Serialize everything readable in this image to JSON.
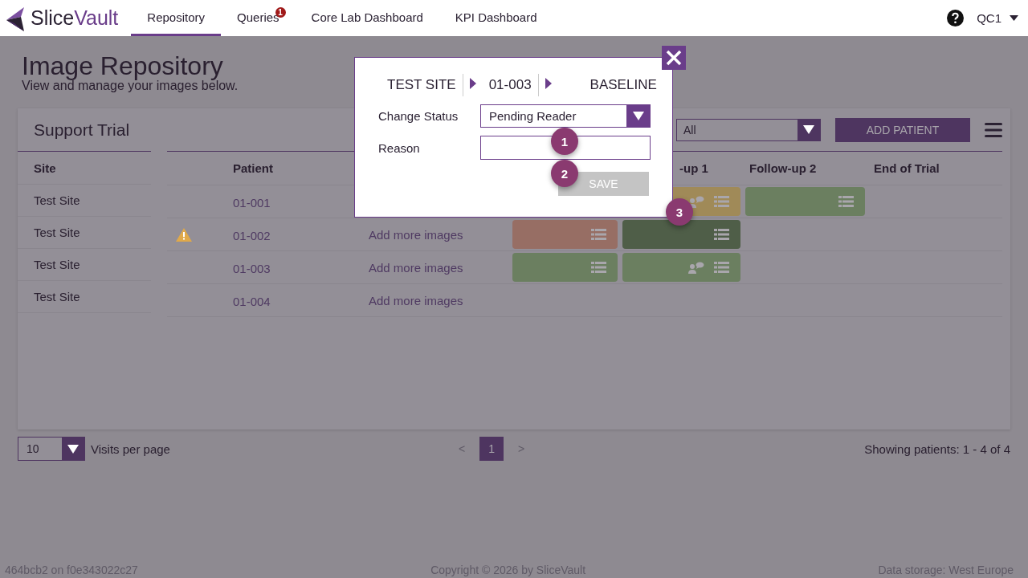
{
  "header": {
    "brand": {
      "part_1": "Slice",
      "part_2": "Vault"
    },
    "nav": [
      {
        "label": "Repository",
        "selected": true
      },
      {
        "label": "Queries",
        "selected": false,
        "badge": "1"
      },
      {
        "label": "Core Lab Dashboard",
        "selected": false
      },
      {
        "label": "KPI Dashboard",
        "selected": false
      }
    ],
    "user": "QC1"
  },
  "page": {
    "title": "Image Repository",
    "subtitle": "View and manage your images below."
  },
  "trial": {
    "name": "Support Trial",
    "filter_value": "All",
    "add_button": "ADD PATIENT",
    "columns": {
      "site": "Site",
      "patient": "Patient",
      "follow_up_1": "-up 1",
      "follow_up_2": "Follow-up 2",
      "end": "End of Trial"
    },
    "rows": [
      {
        "site": "Test Site",
        "warning": false,
        "patient": "01-001",
        "visits": [
          {
            "kind": "empty"
          },
          {
            "kind": "tile",
            "color": "#a08a58",
            "comment": true
          },
          {
            "kind": "tile",
            "color": "#6b7f60",
            "comment": false
          }
        ]
      },
      {
        "site": "Test Site",
        "warning": true,
        "patient": "01-002",
        "link": "Add more images",
        "visits": [
          {
            "kind": "tile",
            "color": "#976e64",
            "comment": false
          },
          {
            "kind": "tile",
            "color": "#4f5e48",
            "comment": false
          }
        ]
      },
      {
        "site": "Test Site",
        "warning": false,
        "patient": "01-003",
        "link": "Add more images",
        "visits": [
          {
            "kind": "tile",
            "color": "#6b7f60",
            "comment": false
          },
          {
            "kind": "tile",
            "color": "#6b7f60",
            "comment": true
          }
        ]
      },
      {
        "site": "Test Site",
        "warning": false,
        "patient": "01-004",
        "link": "Add more images"
      }
    ]
  },
  "pager": {
    "per_page": "10",
    "per_page_label": "Visits per page",
    "prev": "<",
    "pages": [
      {
        "label": "1",
        "selected": true
      }
    ],
    "next": ">",
    "summary": "Showing patients: 1 - 4 of 4"
  },
  "footer": {
    "build": "464bcb2 on f0e343022c27",
    "copyright": "Copyright © 2026 by SliceVault",
    "storage": "Data storage: West Europe"
  },
  "modal": {
    "breadcrumb": [
      "TEST SITE",
      "01-003",
      "BASELINE"
    ],
    "status_label": "Change Status",
    "status_value": "Pending Reader",
    "reason_label": "Reason",
    "save": "SAVE",
    "save_disabled": true
  },
  "markers": [
    "1",
    "2",
    "3"
  ]
}
